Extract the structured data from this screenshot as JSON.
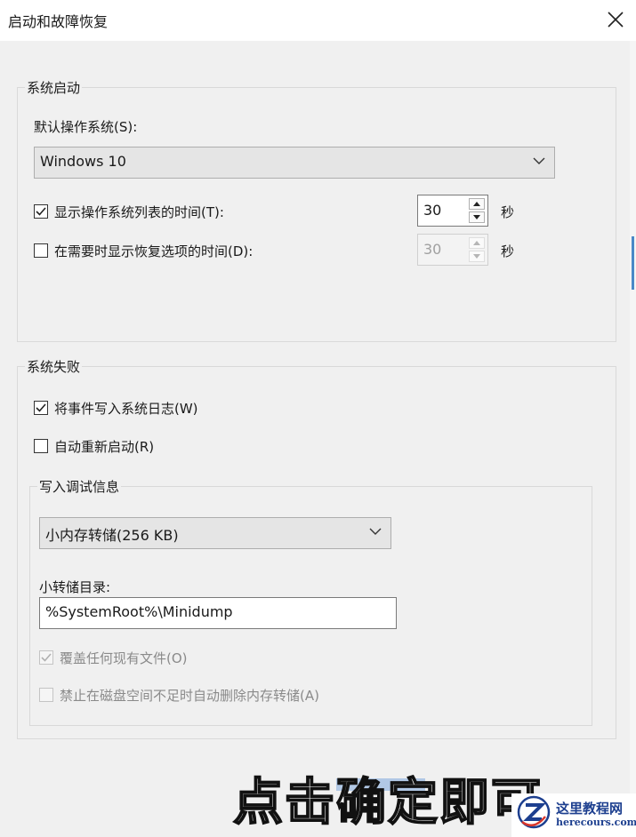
{
  "window": {
    "title": "启动和故障恢复"
  },
  "system_startup": {
    "legend": "系统启动",
    "default_os_label": "默认操作系统(S):",
    "default_os_value": "Windows 10",
    "show_list": {
      "label": "显示操作系统列表的时间(T):",
      "checked": true,
      "value": "30",
      "unit": "秒"
    },
    "show_recovery": {
      "label": "在需要时显示恢复选项的时间(D):",
      "checked": false,
      "value": "30",
      "unit": "秒"
    }
  },
  "system_failure": {
    "legend": "系统失败",
    "write_event": {
      "label": "将事件写入系统日志(W)",
      "checked": true
    },
    "auto_restart": {
      "label": "自动重新启动(R)",
      "checked": false
    },
    "debug": {
      "legend": "写入调试信息",
      "dump_type": "小内存转储(256 KB)",
      "dump_dir_label": "小转储目录:",
      "dump_dir_value": "%SystemRoot%\\Minidump",
      "overwrite": {
        "label": "覆盖任何现有文件(O)",
        "checked": true,
        "disabled": true
      },
      "disable_autodelete": {
        "label": "禁止在磁盘空间不足时自动删除内存转储(A)",
        "checked": false,
        "disabled": true
      }
    }
  },
  "overlay_caption": "点击确定即可",
  "watermark": {
    "cn": "这里教程网",
    "en": "herecours.com"
  },
  "colors": {
    "accent": "#3d7fd1",
    "watermark": "#1d3f8f"
  }
}
